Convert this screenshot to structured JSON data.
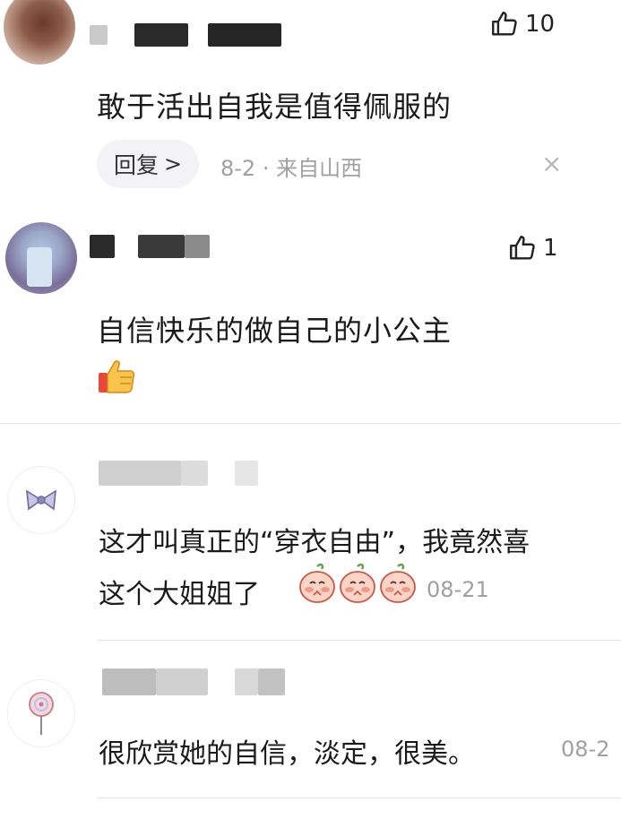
{
  "comments": [
    {
      "likes": "10",
      "text": "敢于活出自我是值得佩服的",
      "reply_label": "回复",
      "reply_chevron": ">",
      "date_location": "8-2 · 来自山西",
      "close_icon": "×"
    },
    {
      "likes": "1",
      "text": "自信快乐的做自己的小公主",
      "emoji": "thumbs-up-emoji"
    }
  ],
  "replies": [
    {
      "text_line1": "这才叫真正的“穿衣自由”，我竟然喜",
      "text_line2": "这个大姐姐了",
      "emojis": [
        "blush-peach-emoji",
        "blush-peach-emoji",
        "blush-peach-emoji"
      ],
      "date": "08-21"
    },
    {
      "text": "很欣赏她的自信，淡定，很美。",
      "date": "08-2"
    }
  ],
  "colors": {
    "meta_gray": "#a0a0a0",
    "pill_bg": "#f3f3f5",
    "divider": "#e6e6e6"
  }
}
